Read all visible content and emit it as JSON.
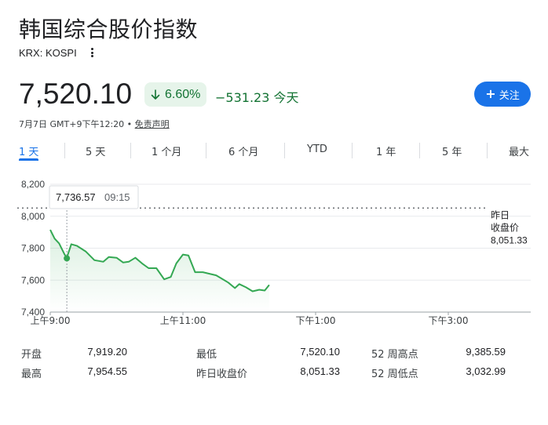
{
  "header": {
    "title": "韩国综合股价指数",
    "ticker": "KRX: KOSPI",
    "more_icon": "more-vert-icon"
  },
  "quote": {
    "price": "7,520.10",
    "change_pct": "6.60%",
    "change_direction": "down",
    "change_abs": "−531.23 今天",
    "change_color": "#137333",
    "badge_bg": "#e6f4ea"
  },
  "follow_button": {
    "label": "关注",
    "icon": "plus-icon",
    "color": "#1a73e8"
  },
  "meta": {
    "timestamp": "7月7日 GMT+9下午12:20",
    "separator": "•",
    "disclaimer": "免责声明"
  },
  "tabs": [
    {
      "label": "1 天",
      "active": true
    },
    {
      "label": "5 天",
      "active": false
    },
    {
      "label": "1 个月",
      "active": false
    },
    {
      "label": "6 个月",
      "active": false
    },
    {
      "label": "YTD",
      "active": false
    },
    {
      "label": "1 年",
      "active": false
    },
    {
      "label": "5 年",
      "active": false
    },
    {
      "label": "最大",
      "active": false
    }
  ],
  "chart_data": {
    "type": "line",
    "y_ticks": [
      "8,200",
      "8,000",
      "7,800",
      "7,600",
      "7,400"
    ],
    "y_tick_values": [
      8200,
      8000,
      7800,
      7600,
      7400
    ],
    "ylim": [
      7400,
      8200
    ],
    "x_ticks": [
      "上午9:00",
      "上午11:00",
      "下午1:00",
      "下午3:00"
    ],
    "x_tick_values": [
      540,
      660,
      780,
      900
    ],
    "xlim": [
      540,
      930
    ],
    "line_color": "#34a853",
    "previous_close": {
      "label_line1": "昨日",
      "label_line2": "收盘价",
      "value_text": "8,051.33",
      "value": 8051.33
    },
    "tooltip": {
      "value": "7,736.57",
      "time": "09:15",
      "x": 555,
      "y": 7736.57
    },
    "x": [
      540,
      544,
      548,
      553,
      555,
      559,
      564,
      572,
      580,
      588,
      593,
      600,
      606,
      611,
      617,
      623,
      629,
      636,
      643,
      647,
      649,
      654,
      660,
      665,
      671,
      678,
      684,
      690,
      695,
      701,
      707,
      711,
      717,
      723,
      729,
      734,
      738
    ],
    "values": [
      7915,
      7860,
      7830,
      7760,
      7740,
      7825,
      7815,
      7780,
      7725,
      7715,
      7745,
      7740,
      7710,
      7715,
      7740,
      7705,
      7675,
      7675,
      7605,
      7615,
      7620,
      7705,
      7760,
      7755,
      7650,
      7650,
      7640,
      7630,
      7610,
      7585,
      7550,
      7575,
      7555,
      7530,
      7540,
      7535,
      7570
    ]
  },
  "stats": [
    {
      "label": "开盘",
      "value": "7,919.20"
    },
    {
      "label": "最高",
      "value": "7,954.55"
    },
    {
      "label": "最低",
      "value": "7,520.10"
    },
    {
      "label": "昨日收盘价",
      "value": "8,051.33"
    },
    {
      "label": "52 周高点",
      "value": "9,385.59"
    },
    {
      "label": "52 周低点",
      "value": "3,032.99"
    }
  ]
}
